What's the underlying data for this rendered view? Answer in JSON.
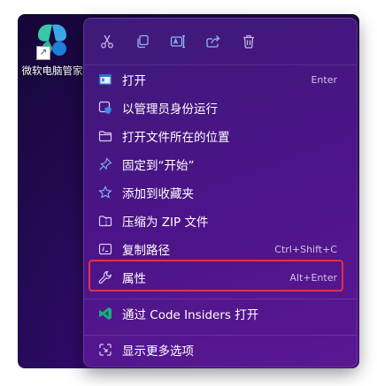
{
  "desktop": {
    "shortcut_label": "微软电脑管家",
    "shortcut_icon": "pc-manager-app-icon"
  },
  "context_menu": {
    "toolbar": [
      {
        "name": "cut",
        "icon": "scissors-icon"
      },
      {
        "name": "copy",
        "icon": "copy-icon"
      },
      {
        "name": "rename",
        "icon": "rename-icon"
      },
      {
        "name": "share",
        "icon": "share-icon"
      },
      {
        "name": "delete",
        "icon": "trash-icon"
      }
    ],
    "items": [
      {
        "label": "打开",
        "shortcut": "Enter",
        "icon": "open-app-icon"
      },
      {
        "label": "以管理员身份运行",
        "shortcut": "",
        "icon": "admin-shield-icon"
      },
      {
        "label": "打开文件所在的位置",
        "shortcut": "",
        "icon": "folder-icon"
      },
      {
        "label": "固定到“开始”",
        "shortcut": "",
        "icon": "pin-icon"
      },
      {
        "label": "添加到收藏夹",
        "shortcut": "",
        "icon": "star-icon"
      },
      {
        "label": "压缩为 ZIP 文件",
        "shortcut": "",
        "icon": "zip-folder-icon"
      },
      {
        "label": "复制路径",
        "shortcut": "Ctrl+Shift+C",
        "icon": "copy-path-icon"
      },
      {
        "label": "属性",
        "shortcut": "Alt+Enter",
        "icon": "wrench-icon"
      },
      {
        "label": "通过 Code Insiders 打开",
        "shortcut": "",
        "icon": "vscode-insiders-icon"
      },
      {
        "label": "显示更多选项",
        "shortcut": "",
        "icon": "more-options-icon"
      }
    ],
    "highlighted_item": "属性",
    "highlight_color": "#e8303a",
    "text_color": "#ffffff"
  }
}
